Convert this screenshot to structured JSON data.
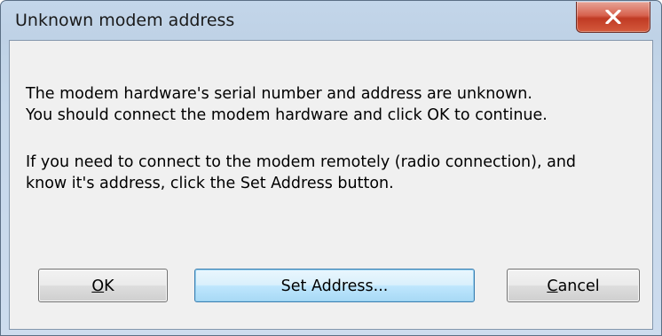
{
  "dialog": {
    "title": "Unknown modem address",
    "message_lines": [
      "The modem hardware's serial number and address are unknown.",
      "You should connect the modem hardware and click OK to continue.",
      "If you need to connect to the modem remotely (radio connection), and",
      "know it's address, click the Set Address button."
    ],
    "buttons": {
      "ok": {
        "accel": "O",
        "rest": "K"
      },
      "set_address": "Set Address...",
      "cancel": {
        "accel": "C",
        "rest": "ancel"
      }
    },
    "icons": {
      "close": "close-icon"
    },
    "colors": {
      "close_button": "#c7432b",
      "default_button_border": "#3c7fb1"
    }
  }
}
